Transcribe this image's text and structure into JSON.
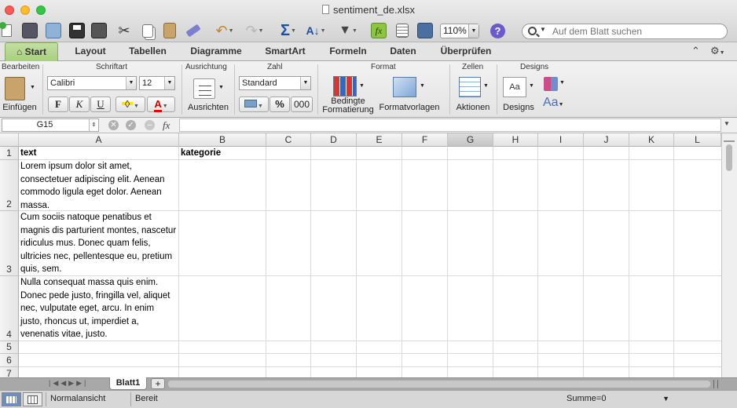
{
  "window": {
    "title": "sentiment_de.xlsx"
  },
  "toolbar": {
    "zoom": "110%",
    "search_placeholder": "Auf dem Blatt suchen"
  },
  "ribbon_tabs": [
    "Start",
    "Layout",
    "Tabellen",
    "Diagramme",
    "SmartArt",
    "Formeln",
    "Daten",
    "Überprüfen"
  ],
  "ribbon": {
    "groups": {
      "bearbeiten": "Bearbeiten",
      "schriftart": "Schriftart",
      "ausrichtung": "Ausrichtung",
      "zahl": "Zahl",
      "format": "Format",
      "zellen": "Zellen",
      "designs": "Designs"
    },
    "einfuegen": "Einfügen",
    "font_name": "Calibri",
    "font_size": "12",
    "bold": "F",
    "italic": "K",
    "underline": "U",
    "ausrichten": "Ausrichten",
    "number_format": "Standard",
    "percent": "%",
    "thousands": "000",
    "bedingte_line1": "Bedingte",
    "bedingte_line2": "Formatierung",
    "formatvorlagen": "Formatvorlagen",
    "aktionen": "Aktionen",
    "designs_btn": "Designs",
    "aa_normal": "Aa",
    "aa_font": "Aa"
  },
  "formula_bar": {
    "name_box": "G15",
    "fx": "fx",
    "value": ""
  },
  "columns": [
    "A",
    "B",
    "C",
    "D",
    "E",
    "F",
    "G",
    "H",
    "I",
    "J",
    "K",
    "L"
  ],
  "rows": [
    {
      "num": "1",
      "a": "text",
      "b": "kategorie"
    },
    {
      "num": "2",
      "a": "Lorem ipsum dolor sit amet, consectetuer adipiscing elit. Aenean commodo ligula eget dolor. Aenean massa.",
      "b": ""
    },
    {
      "num": "3",
      "a": "Cum sociis natoque penatibus et magnis dis parturient montes, nascetur ridiculus mus. Donec quam felis, ultricies nec, pellentesque eu, pretium quis, sem.",
      "b": ""
    },
    {
      "num": "4",
      "a": "Nulla consequat massa quis enim. Donec pede justo, fringilla vel, aliquet nec, vulputate eget, arcu. In enim justo, rhoncus ut, imperdiet a, venenatis vitae, justo.",
      "b": ""
    },
    {
      "num": "5",
      "a": "",
      "b": ""
    },
    {
      "num": "6",
      "a": "",
      "b": ""
    },
    {
      "num": "7",
      "a": "",
      "b": ""
    }
  ],
  "sheets": {
    "active": "Blatt1",
    "add": "+"
  },
  "status": {
    "view": "Normalansicht",
    "state": "Bereit",
    "sum": "Summe=0"
  },
  "colors": {
    "ribbon_tab_active": "#a8cf7e",
    "fx_active": "#8cc63f"
  }
}
